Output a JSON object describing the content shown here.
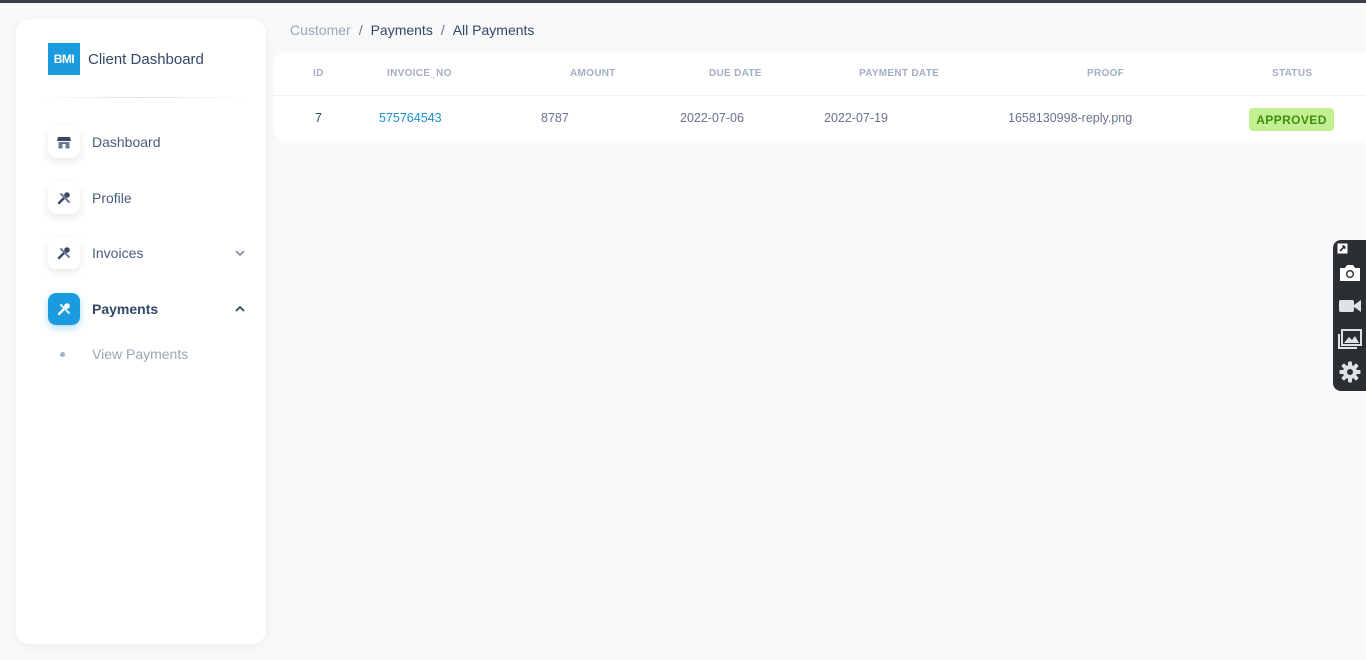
{
  "sidebar": {
    "brand_logo": "BMI",
    "brand_name": "Client Dashboard",
    "items": [
      {
        "label": "Dashboard",
        "icon": "shop-icon"
      },
      {
        "label": "Profile",
        "icon": "tools-icon"
      },
      {
        "label": "Invoices",
        "icon": "tools-icon",
        "chevron": "chevron-down-icon"
      },
      {
        "label": "Payments",
        "icon": "tools-icon",
        "chevron": "chevron-up-icon",
        "active": true
      }
    ],
    "sub_items": [
      {
        "label": "View Payments"
      }
    ]
  },
  "breadcrumb": [
    "Customer",
    "Payments",
    "All Payments"
  ],
  "table": {
    "columns": [
      "ID",
      "INVOICE_NO",
      "AMOUNT",
      "DUE DATE",
      "PAYMENT DATE",
      "PROOF",
      "STATUS"
    ],
    "rows": [
      {
        "id": "7",
        "invoice_no": "575764543",
        "amount": "8787",
        "due_date": "2022-07-06",
        "payment_date": "2022-07-19",
        "proof": "1658130998-reply.png",
        "status": "APPROVED"
      }
    ]
  },
  "toolbar": {
    "tools": [
      "pin-icon",
      "camera-icon",
      "video-icon",
      "gallery-icon",
      "settings-icon"
    ]
  },
  "colors": {
    "accent": "#1a9be0",
    "status_approved_bg": "#c2ef92",
    "status_approved_text": "#3f8e13",
    "background": "#f8f9fa"
  }
}
